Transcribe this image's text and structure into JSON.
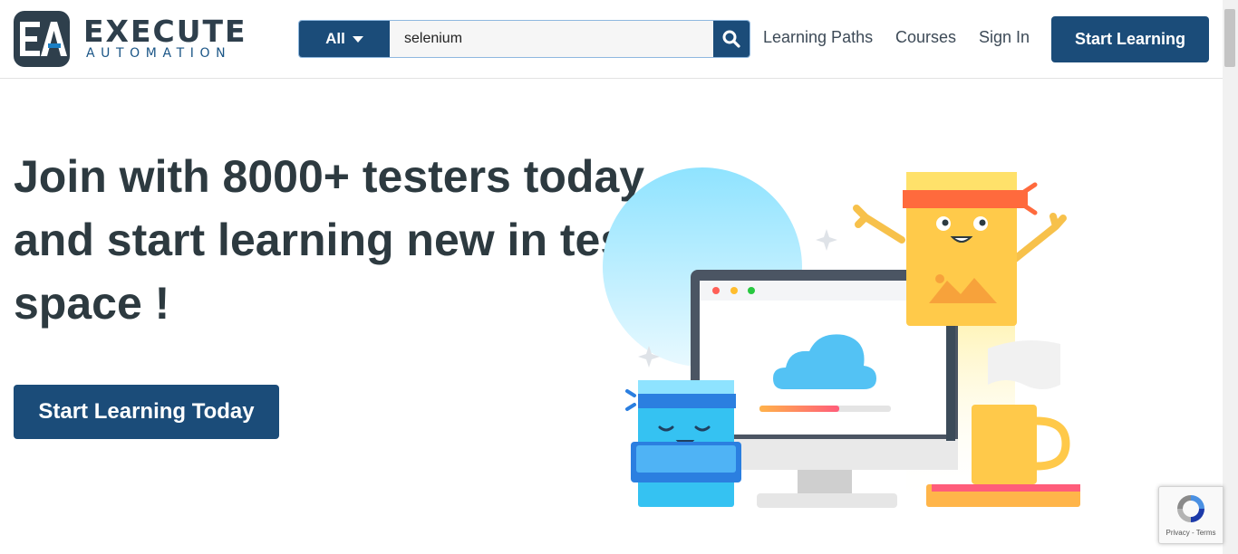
{
  "brand": {
    "name": "EXECUTE",
    "tagline": "AUTOMATION",
    "colors": {
      "primary": "#1b4c79",
      "dark": "#2e3f4c"
    }
  },
  "search": {
    "category": "All",
    "value": "selenium",
    "icon": "search-icon"
  },
  "nav": {
    "items": [
      "Learning Paths",
      "Courses",
      "Sign In"
    ],
    "cta": "Start Learning"
  },
  "hero": {
    "title": "Join with 8000+ testers today and start learning new in testing space !",
    "cta": "Start Learning Today"
  },
  "recaptcha": {
    "privacy": "Privacy",
    "separator": "-",
    "terms": "Terms"
  }
}
